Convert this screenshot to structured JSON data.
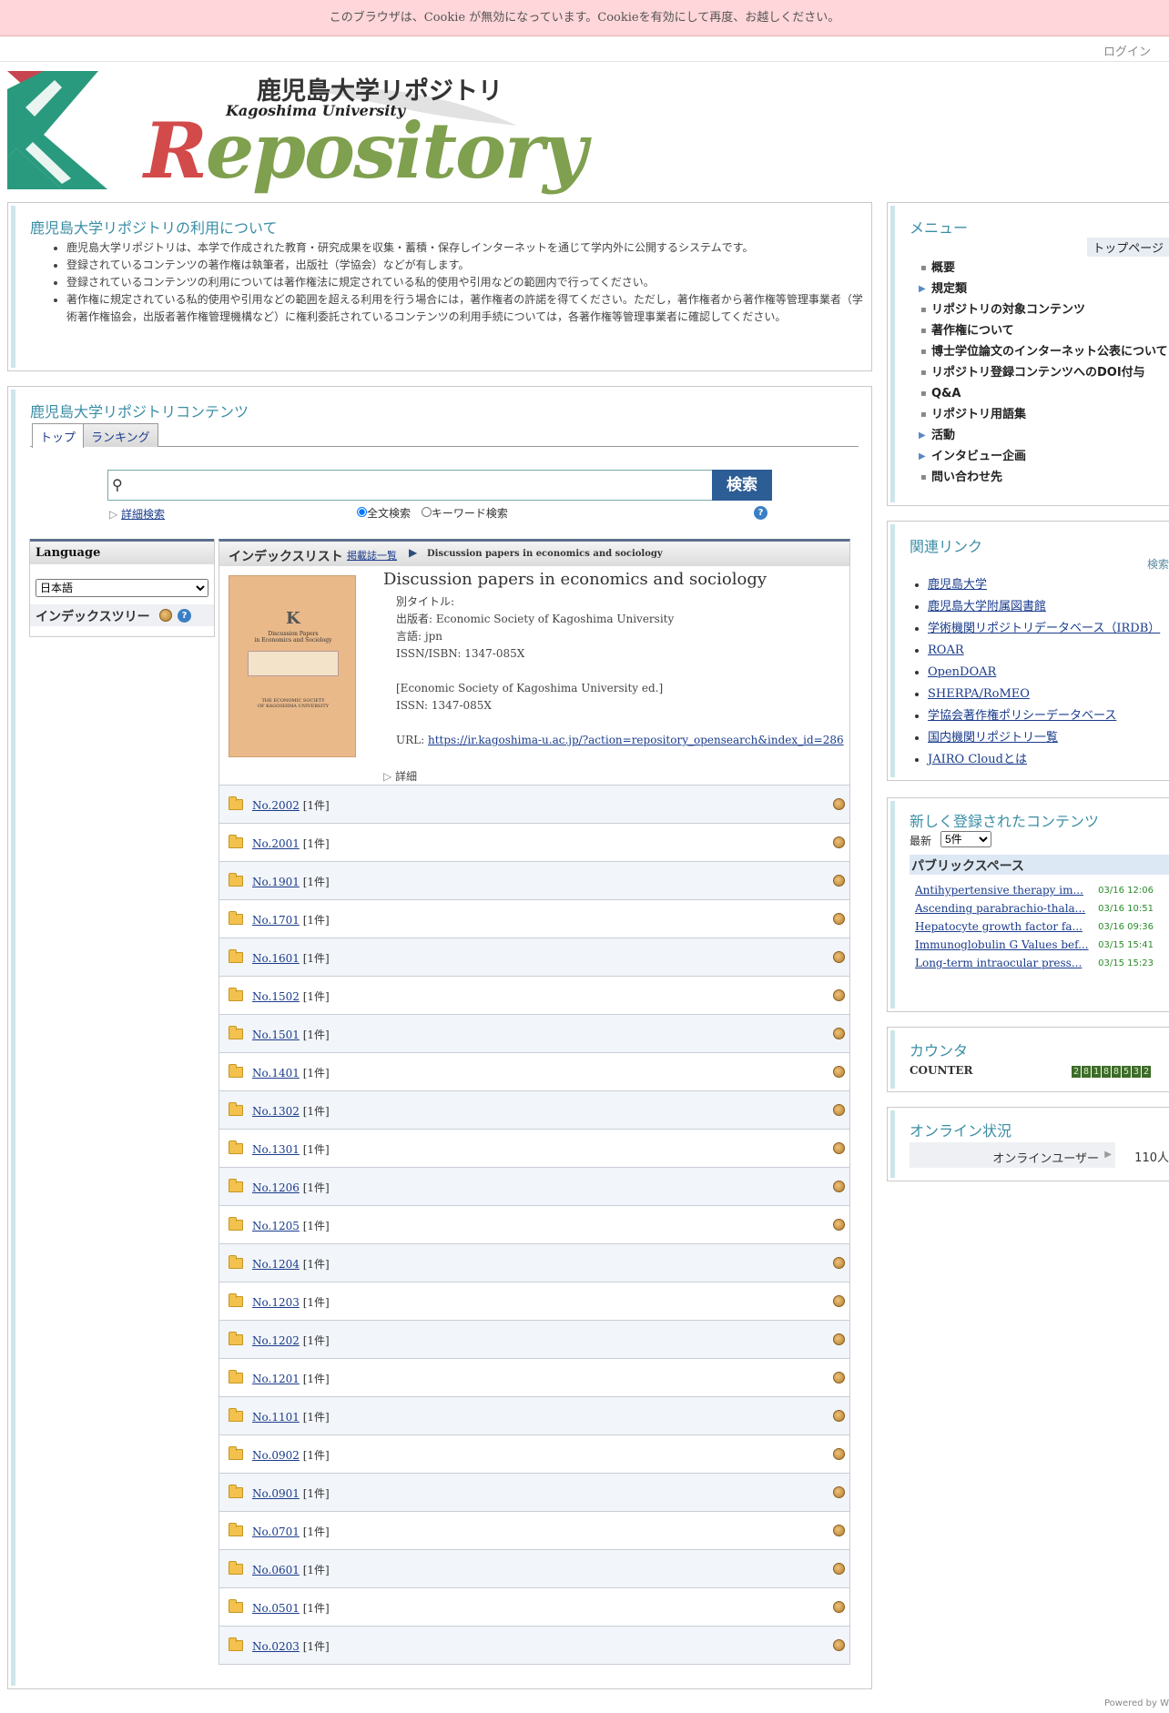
{
  "cookie_message": "このブラウザは、Cookie が無効になっています。Cookieを有効にして再度、お越しください。",
  "login": "ログイン",
  "logo": {
    "jp": "鹿児島大学リポジトリ",
    "en_small": "Kagoshima University",
    "en_big": "Repository"
  },
  "about": {
    "title": "鹿児島大学リポジトリの利用について",
    "items": [
      "鹿児島大学リポジトリは、本学で作成された教育・研究成果を収集・蓄積・保存しインターネットを通じて学内外に公開するシステムです。",
      "登録されているコンテンツの著作権は執筆者，出版社（学協会）などが有します。",
      "登録されているコンテンツの利用については著作権法に規定されている私的使用や引用などの範囲内で行ってください。",
      "著作権に規定されている私的使用や引用などの範囲を超える利用を行う場合には，著作権者の許諾を得てください。ただし，著作権者から著作権等管理事業者（学術著作権協会，出版者著作権管理機構など）に権利委託されているコンテンツの利用手続については，各著作権等管理事業者に確認してください。"
    ]
  },
  "contents": {
    "title": "鹿児島大学リポジトリコンテンツ",
    "tabs": [
      "トップ",
      "ランキング"
    ],
    "search_button": "検索",
    "advanced_search": "詳細検索",
    "radio_fulltext": "全文検索",
    "radio_keyword": "キーワード検索"
  },
  "sidebar_left": {
    "language_title": "Language",
    "language_selected": "日本語",
    "index_tree": "インデックスツリー"
  },
  "index": {
    "title": "インデックスリスト",
    "breadcrumb_link": "掲載誌一覧",
    "breadcrumb_current": "Discussion papers in economics and sociology",
    "cover_text": [
      "Discussion Papers",
      "in Economics and Sociology",
      "THE ECONOMIC SOCIETY",
      "OF KAGOSHIMA UNIVERSITY"
    ],
    "journal_title": "Discussion papers in economics and sociology",
    "alt_title": "別タイトル:",
    "publisher": "出版者: Economic Society of Kagoshima University",
    "language": "言語: jpn",
    "issn_isbn": "ISSN/ISBN: 1347-085X",
    "ed": "[Economic Society of Kagoshima University ed.]",
    "issn": "ISSN: 1347-085X",
    "url_label": "URL: ",
    "url": "https://ir.kagoshima-u.ac.jp/?action=repository_opensearch&index_id=286",
    "detail": "詳細",
    "rows": [
      {
        "no": "No.2002",
        "count": "[1件]"
      },
      {
        "no": "No.2001",
        "count": "[1件]"
      },
      {
        "no": "No.1901",
        "count": "[1件]"
      },
      {
        "no": "No.1701",
        "count": "[1件]"
      },
      {
        "no": "No.1601",
        "count": "[1件]"
      },
      {
        "no": "No.1502",
        "count": "[1件]"
      },
      {
        "no": "No.1501",
        "count": "[1件]"
      },
      {
        "no": "No.1401",
        "count": "[1件]"
      },
      {
        "no": "No.1302",
        "count": "[1件]"
      },
      {
        "no": "No.1301",
        "count": "[1件]"
      },
      {
        "no": "No.1206",
        "count": "[1件]"
      },
      {
        "no": "No.1205",
        "count": "[1件]"
      },
      {
        "no": "No.1204",
        "count": "[1件]"
      },
      {
        "no": "No.1203",
        "count": "[1件]"
      },
      {
        "no": "No.1202",
        "count": "[1件]"
      },
      {
        "no": "No.1201",
        "count": "[1件]"
      },
      {
        "no": "No.1101",
        "count": "[1件]"
      },
      {
        "no": "No.0902",
        "count": "[1件]"
      },
      {
        "no": "No.0901",
        "count": "[1件]"
      },
      {
        "no": "No.0701",
        "count": "[1件]"
      },
      {
        "no": "No.0601",
        "count": "[1件]"
      },
      {
        "no": "No.0501",
        "count": "[1件]"
      },
      {
        "no": "No.0203",
        "count": "[1件]"
      }
    ]
  },
  "menu": {
    "title": "メニュー",
    "top_page": "トップページ",
    "items": [
      {
        "label": "概要",
        "tri": false
      },
      {
        "label": "規定類",
        "tri": true
      },
      {
        "label": "リポジトリの対象コンテンツ",
        "tri": false
      },
      {
        "label": "著作権について",
        "tri": false
      },
      {
        "label": "博士学位論文のインターネット公表について",
        "tri": false
      },
      {
        "label": "リポジトリ登録コンテンツへのDOI付与",
        "tri": false
      },
      {
        "label": "Q&A",
        "tri": false
      },
      {
        "label": "リポジトリ用語集",
        "tri": false
      },
      {
        "label": "活動",
        "tri": true
      },
      {
        "label": "インタビュー企画",
        "tri": true
      },
      {
        "label": "問い合わせ先",
        "tri": false
      }
    ]
  },
  "related": {
    "title": "関連リンク",
    "search": "検索",
    "links": [
      "鹿児島大学",
      "鹿児島大学附属図書館",
      "学術機関リポジトリデータベース（IRDB）",
      "ROAR",
      "OpenDOAR",
      "SHERPA/RoMEO",
      "学協会著作権ポリシーデータベース",
      "国内機関リポジトリ一覧",
      "JAIRO Cloudとは"
    ]
  },
  "newitems": {
    "title": "新しく登録されたコンテンツ",
    "latest_label": "最新",
    "latest_value": "5件",
    "space": "パブリックスペース",
    "items": [
      {
        "title": "Antihypertensive therapy im...",
        "date": "03/16 12:06"
      },
      {
        "title": "Ascending parabrachio-thala...",
        "date": "03/16 10:51"
      },
      {
        "title": "Hepatocyte growth factor fa...",
        "date": "03/16 09:36"
      },
      {
        "title": "Immunoglobulin G Values bef...",
        "date": "03/15 15:41"
      },
      {
        "title": "Long-term intraocular press...",
        "date": "03/15 15:23"
      }
    ]
  },
  "counter": {
    "title": "カウンタ",
    "label": "COUNTER",
    "value": "28188532"
  },
  "online": {
    "title": "オンライン状況",
    "label": "オンラインユーザー",
    "count": "110人"
  },
  "powered_by": "Powered by W"
}
